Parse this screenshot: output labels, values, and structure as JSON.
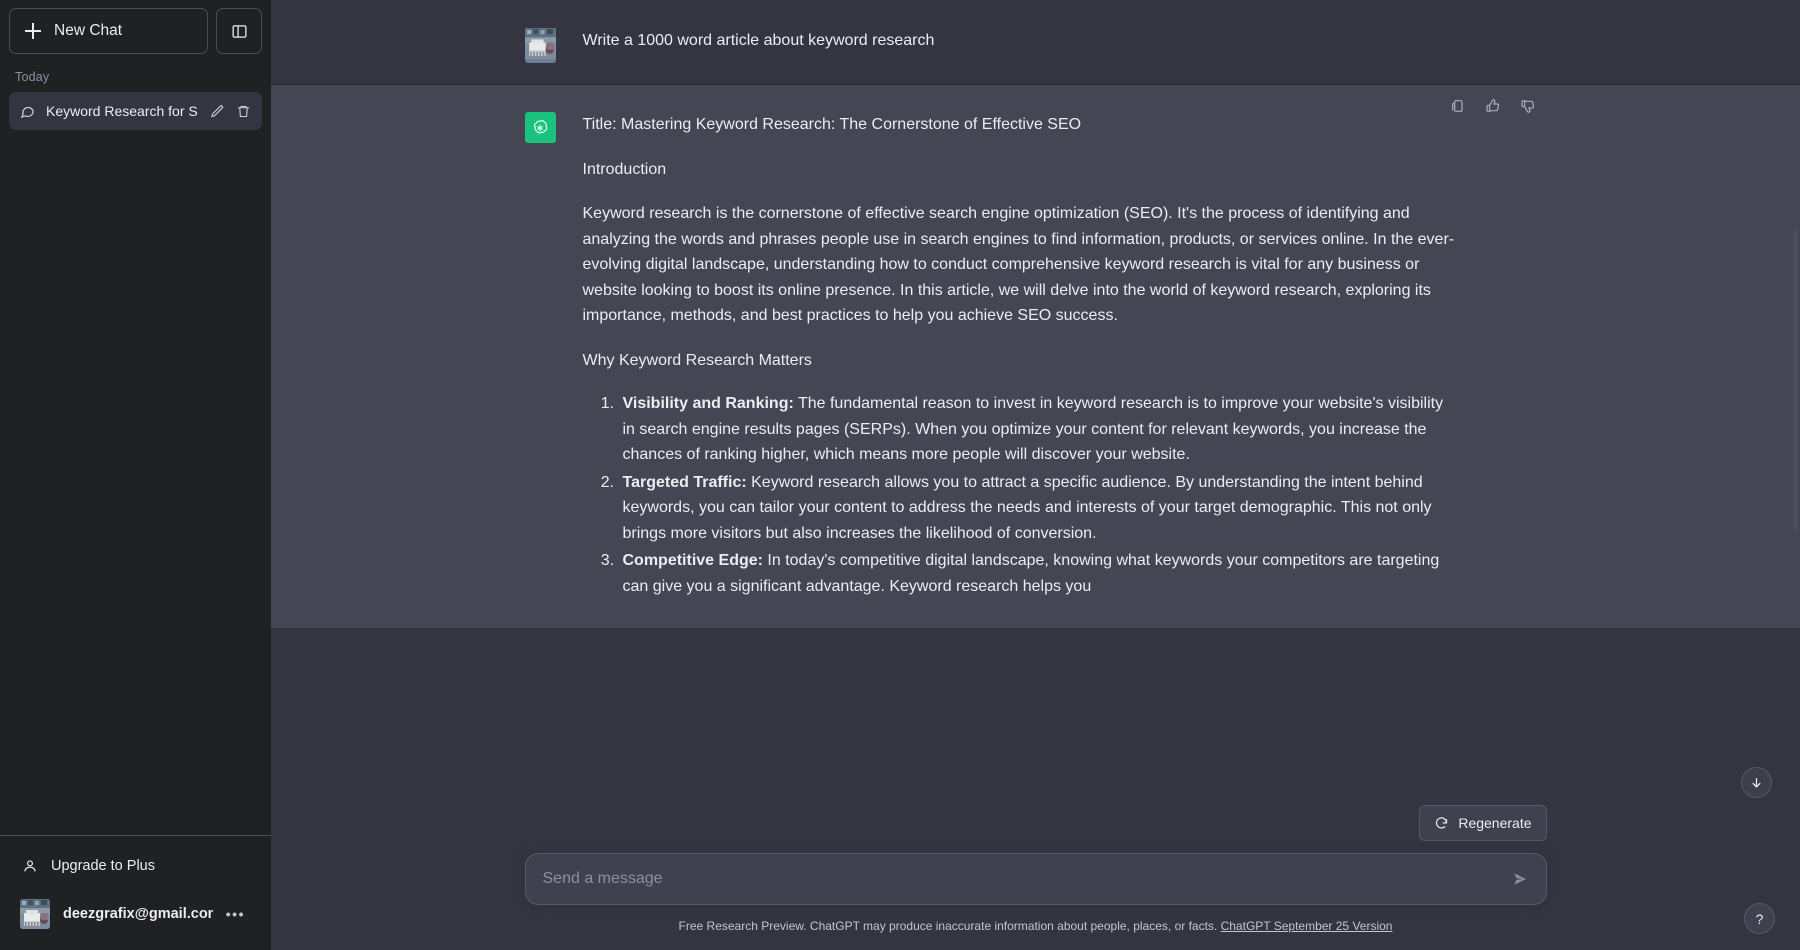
{
  "sidebar": {
    "new_chat_label": "New Chat",
    "new_chat_icon": "plus-icon",
    "collapse_icon": "sidebar-toggle-icon",
    "history_group_label": "Today",
    "chats": [
      {
        "title": "Keyword Research for S",
        "icon": "chat-bubble-icon",
        "edit_icon": "pencil-icon",
        "delete_icon": "trash-icon"
      }
    ],
    "upgrade_label": "Upgrade to Plus",
    "upgrade_icon": "person-icon",
    "account_email": "deezgrafix@gmail.com",
    "account_menu_icon": "ellipsis-icon"
  },
  "conversation": {
    "messages": [
      {
        "role": "user",
        "avatar": "user-photo-avatar",
        "text": "Write a 1000 word article about keyword research"
      },
      {
        "role": "assistant",
        "avatar": "chatgpt-logo",
        "title_line": "Title: Mastering Keyword Research: The Cornerstone of Effective SEO",
        "heading_intro": "Introduction",
        "paragraph_intro": "Keyword research is the cornerstone of effective search engine optimization (SEO). It's the process of identifying and analyzing the words and phrases people use in search engines to find information, products, or services online. In the ever-evolving digital landscape, understanding how to conduct comprehensive keyword research is vital for any business or website looking to boost its online presence. In this article, we will delve into the world of keyword research, exploring its importance, methods, and best practices to help you achieve SEO success.",
        "heading_why": "Why Keyword Research Matters",
        "list_items": [
          {
            "bold": "Visibility and Ranking:",
            "text": " The fundamental reason to invest in keyword research is to improve your website's visibility in search engine results pages (SERPs). When you optimize your content for relevant keywords, you increase the chances of ranking higher, which means more people will discover your website."
          },
          {
            "bold": "Targeted Traffic:",
            "text": " Keyword research allows you to attract a specific audience. By understanding the intent behind keywords, you can tailor your content to address the needs and interests of your target demographic. This not only brings more visitors but also increases the likelihood of conversion."
          },
          {
            "bold": "Competitive Edge:",
            "text": " In today's competitive digital landscape, knowing what keywords your competitors are targeting can give you a significant advantage. Keyword research helps you"
          }
        ],
        "actions": [
          {
            "name": "copy-icon",
            "label": "Copy"
          },
          {
            "name": "thumbs-up-icon",
            "label": "Good response"
          },
          {
            "name": "thumbs-down-icon",
            "label": "Bad response"
          }
        ]
      }
    ]
  },
  "composer": {
    "regenerate_label": "Regenerate",
    "regenerate_icon": "refresh-icon",
    "input_placeholder": "Send a message",
    "input_value": "",
    "send_icon": "send-arrow-icon"
  },
  "footer": {
    "disclaimer": "Free Research Preview. ChatGPT may produce inaccurate information about people, places, or facts.",
    "version_link": "ChatGPT September 25 Version"
  },
  "floating": {
    "scroll_down_icon": "arrow-down-icon",
    "help_label": "?",
    "help_icon": "question-mark-icon"
  },
  "colors": {
    "sidebar_bg": "#202123",
    "user_row_bg": "#343541",
    "assistant_row_bg": "#444654",
    "accent_green": "#19c37d",
    "text_primary": "#ececf1",
    "text_muted": "#8e8ea0",
    "border": "#565869"
  }
}
